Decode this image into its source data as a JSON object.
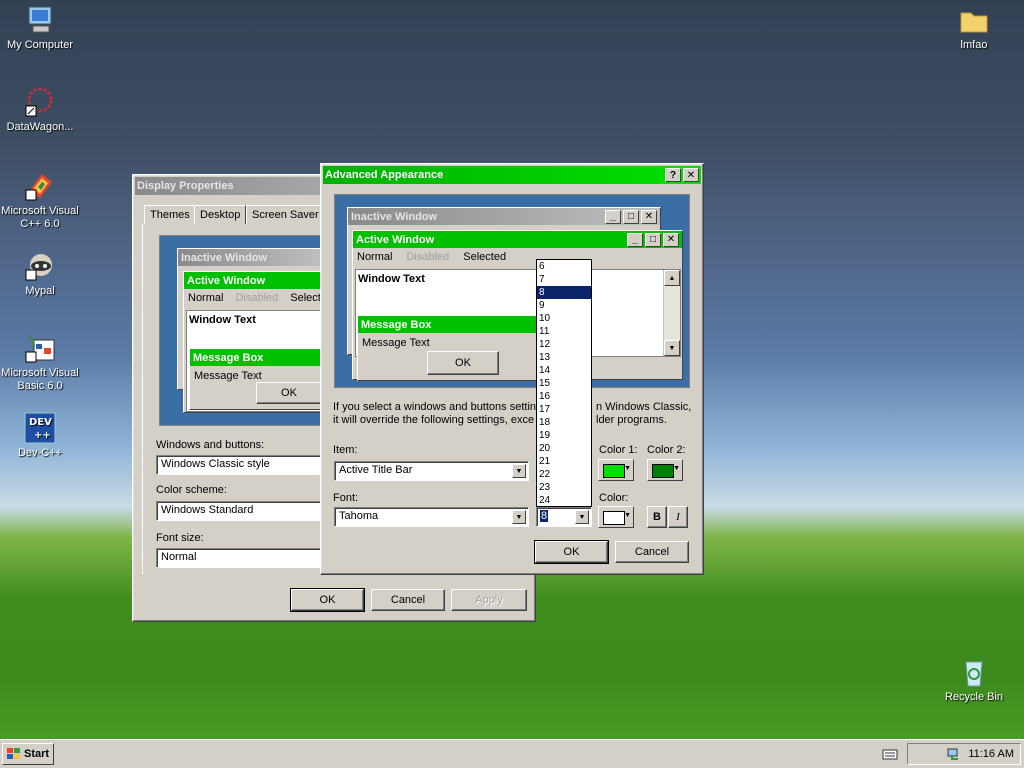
{
  "desktop": {
    "icons": [
      {
        "label": "My Computer"
      },
      {
        "label": "DataWagon..."
      },
      {
        "label": "Microsoft Visual C++ 6.0"
      },
      {
        "label": "Mypal"
      },
      {
        "label": "Microsoft Visual Basic 6.0"
      },
      {
        "label": "Dev-C++"
      },
      {
        "label": "lmfao"
      },
      {
        "label": "Recycle Bin"
      }
    ]
  },
  "display_properties": {
    "title": "Display Properties",
    "tabs": [
      "Themes",
      "Desktop",
      "Screen Saver"
    ],
    "preview": {
      "inactive_title": "Inactive Window",
      "active_title": "Active Window",
      "menu_normal": "Normal",
      "menu_disabled": "Disabled",
      "menu_selected": "Selecte",
      "window_text": "Window Text",
      "message_box_title": "Message Box",
      "message_text": "Message Text",
      "ok": "OK"
    },
    "windows_buttons_label": "Windows and buttons:",
    "windows_buttons_value": "Windows Classic style",
    "color_scheme_label": "Color scheme:",
    "color_scheme_value": "Windows Standard",
    "font_size_label": "Font size:",
    "font_size_value": "Normal",
    "ok": "OK",
    "cancel": "Cancel",
    "apply": "Apply"
  },
  "advanced_appearance": {
    "title": "Advanced Appearance",
    "help": "?",
    "close": "✕",
    "preview": {
      "inactive_title": "Inactive Window",
      "active_title": "Active Window",
      "menu_normal": "Normal",
      "menu_disabled": "Disabled",
      "menu_selected": "Selected",
      "window_text": "Window Text",
      "message_box_title": "Message Box",
      "message_text": "Message Text",
      "ok": "OK"
    },
    "info_line1": "If you select a windows and buttons settin",
    "info_line1b": "n Windows Classic,",
    "info_line2": "it will override the following settings, exce",
    "info_line2b": "lder programs.",
    "item_label": "Item:",
    "item_value": "Active Title Bar",
    "font_label": "Font:",
    "font_value": "Tahoma",
    "size_value": "8",
    "color1_label": "Color 1:",
    "color2_label": "Color 2:",
    "color_label": "Color:",
    "bold": "B",
    "italic": "I",
    "ok": "OK",
    "cancel": "Cancel",
    "size_options": [
      "6",
      "7",
      "8",
      "9",
      "10",
      "11",
      "12",
      "13",
      "14",
      "15",
      "16",
      "17",
      "18",
      "19",
      "20",
      "21",
      "22",
      "23",
      "24"
    ],
    "selected_size": "8"
  },
  "colors": {
    "active_title": "#00c000",
    "color1": "#00e000",
    "color2": "#008000",
    "font_color": "#ffffff",
    "highlight": "#0a246a"
  },
  "taskbar": {
    "start": "Start",
    "time": "11:16 AM"
  }
}
